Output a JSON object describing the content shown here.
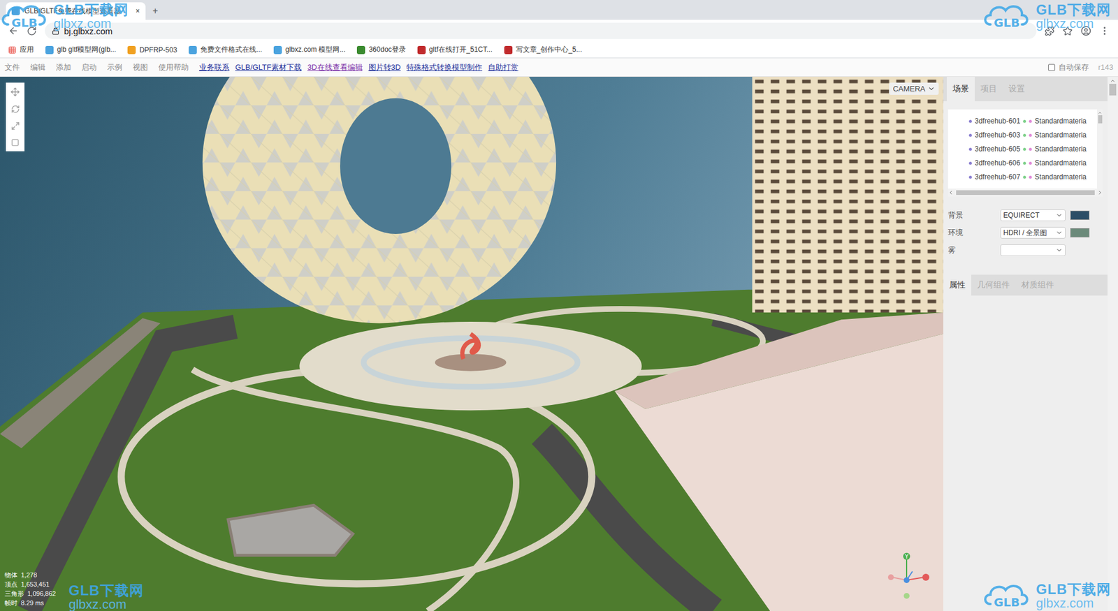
{
  "browser": {
    "tab": {
      "title": "GLB/GLTF免费在线模型查看器",
      "close": "×"
    },
    "new_tab": "+",
    "url": "bj.glbxz.com",
    "bookmarks": [
      {
        "label": "应用",
        "color": "#e8453c"
      },
      {
        "label": "glb gltf模型网(glb...",
        "color": "#4aa3df"
      },
      {
        "label": "DPFRP-503",
        "color": "#f0a020"
      },
      {
        "label": "免费文件格式在线...",
        "color": "#4aa3df"
      },
      {
        "label": "glbxz.com 模型网...",
        "color": "#4aa3df"
      },
      {
        "label": "360doc登录",
        "color": "#3a8a2e"
      },
      {
        "label": "gltf在线打开_51CT...",
        "color": "#c0292b"
      },
      {
        "label": "写文章_创作中心_5...",
        "color": "#c0292b"
      }
    ]
  },
  "menu": {
    "items": [
      "文件",
      "编辑",
      "添加",
      "启动",
      "示例",
      "视图",
      "使用帮助"
    ],
    "links": [
      {
        "label": "业务联系",
        "visited": false
      },
      {
        "label": "GLB/GLTF素材下载",
        "visited": false
      },
      {
        "label": "3D在线查看编辑",
        "visited": true
      },
      {
        "label": "图片转3D",
        "visited": false
      },
      {
        "label": "特殊格式转换模型制作",
        "visited": false
      },
      {
        "label": "自助打赏",
        "visited": false
      }
    ],
    "autosave": {
      "label": "自动保存",
      "checked": false
    },
    "version": "r143"
  },
  "viewport": {
    "camera": "CAMERA",
    "stats": [
      {
        "label": "物体",
        "value": "1,278"
      },
      {
        "label": "顶点",
        "value": "1,653,451"
      },
      {
        "label": "三角形",
        "value": "1,096,862"
      },
      {
        "label": "帧时",
        "value": "8.29 ms"
      }
    ],
    "axis": "Y"
  },
  "sidebar": {
    "tabs": [
      {
        "label": "场景",
        "selected": true
      },
      {
        "label": "项目",
        "selected": false
      },
      {
        "label": "设置",
        "selected": false
      }
    ],
    "outliner": [
      {
        "name": "3dfreehub-601",
        "material": "Standardmateria"
      },
      {
        "name": "3dfreehub-603",
        "material": "Standardmateria"
      },
      {
        "name": "3dfreehub-605",
        "material": "Standardmateria"
      },
      {
        "name": "3dfreehub-606",
        "material": "Standardmateria"
      },
      {
        "name": "3dfreehub-607",
        "material": "Standardmateria"
      }
    ],
    "properties": [
      {
        "label": "背景",
        "value": "EQUIRECT",
        "swatch": "#2c4d66"
      },
      {
        "label": "环境",
        "value": "HDRI / 全景图",
        "swatch": "#6b8a7a"
      },
      {
        "label": "雾",
        "value": ""
      }
    ],
    "panel_tabs": [
      {
        "label": "属性",
        "selected": true
      },
      {
        "label": "几何组件",
        "selected": false
      },
      {
        "label": "材质组件",
        "selected": false
      }
    ]
  },
  "watermarks": [
    {
      "place": "top-left",
      "logo": "GLB",
      "title": "GLB下载网",
      "url": "glbxz.com"
    },
    {
      "place": "top-right",
      "logo": "GLB",
      "title": "GLB下载网",
      "url": "glbxz.com"
    },
    {
      "place": "bottom-left",
      "title": "GLB下载网",
      "url": "glbxz.com"
    },
    {
      "place": "bottom-right",
      "logo": "GLB",
      "title": "GLB下载网",
      "url": "glbxz.com"
    }
  ]
}
